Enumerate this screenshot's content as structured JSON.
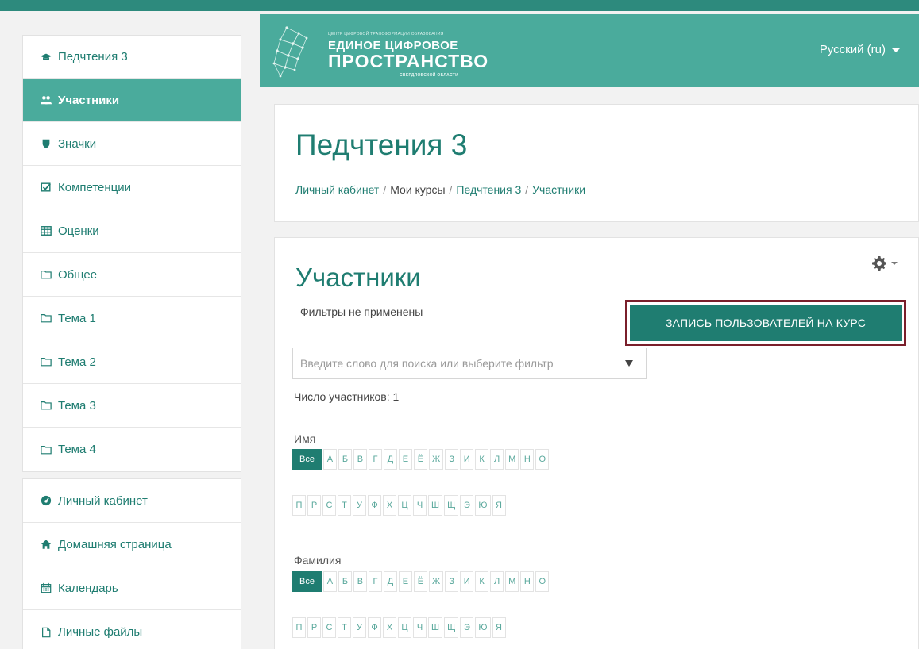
{
  "colors": {
    "accent": "#4aab9c",
    "accent_dark": "#1f7d71",
    "highlight_border": "#7a1f2b"
  },
  "sidebar": {
    "course_items": [
      {
        "label": "Педчтения 3",
        "icon": "graduation-cap-icon"
      },
      {
        "label": "Участники",
        "icon": "users-icon"
      },
      {
        "label": "Значки",
        "icon": "shield-icon"
      },
      {
        "label": "Компетенции",
        "icon": "check-square-icon"
      },
      {
        "label": "Оценки",
        "icon": "table-icon"
      },
      {
        "label": "Общее",
        "icon": "folder-icon"
      },
      {
        "label": "Тема 1",
        "icon": "folder-icon"
      },
      {
        "label": "Тема 2",
        "icon": "folder-icon"
      },
      {
        "label": "Тема 3",
        "icon": "folder-icon"
      },
      {
        "label": "Тема 4",
        "icon": "folder-icon"
      }
    ],
    "global_items": [
      {
        "label": "Личный кабинет",
        "icon": "dashboard-icon"
      },
      {
        "label": "Домашняя страница",
        "icon": "home-icon"
      },
      {
        "label": "Календарь",
        "icon": "calendar-icon"
      },
      {
        "label": "Личные файлы",
        "icon": "file-icon"
      }
    ]
  },
  "header": {
    "logo_small": "ЦЕНТР ЦИФРОВОЙ ТРАНСФОРМАЦИИ ОБРАЗОВАНИЯ",
    "logo_line1": "ЕДИНОЕ ЦИФРОВОЕ",
    "logo_line2": "ПРОСТРАНСТВО",
    "logo_line3": "СВЕРДЛОВСКОЙ ОБЛАСТИ",
    "language": "Русский (ru)"
  },
  "course": {
    "title": "Педчтения 3",
    "breadcrumb": [
      "Личный кабинет",
      "Мои курсы",
      "Педчтения 3",
      "Участники"
    ]
  },
  "participants": {
    "title": "Участники",
    "filters_note": "Фильтры не применены",
    "enrol_button": "ЗАПИСЬ ПОЛЬЗОВАТЕЛЕЙ НА КУРС",
    "search_placeholder": "Введите слово для поиска или выберите фильтр",
    "count": "Число участников: 1",
    "firstname_label": "Имя",
    "lastname_label": "Фамилия",
    "all_label": "Все",
    "letters_row1": [
      "А",
      "Б",
      "В",
      "Г",
      "Д",
      "Е",
      "Ё",
      "Ж",
      "З",
      "И",
      "К",
      "Л",
      "М",
      "Н",
      "О"
    ],
    "letters_row2": [
      "П",
      "Р",
      "С",
      "Т",
      "У",
      "Ф",
      "Х",
      "Ц",
      "Ч",
      "Ш",
      "Щ",
      "Э",
      "Ю",
      "Я"
    ]
  }
}
